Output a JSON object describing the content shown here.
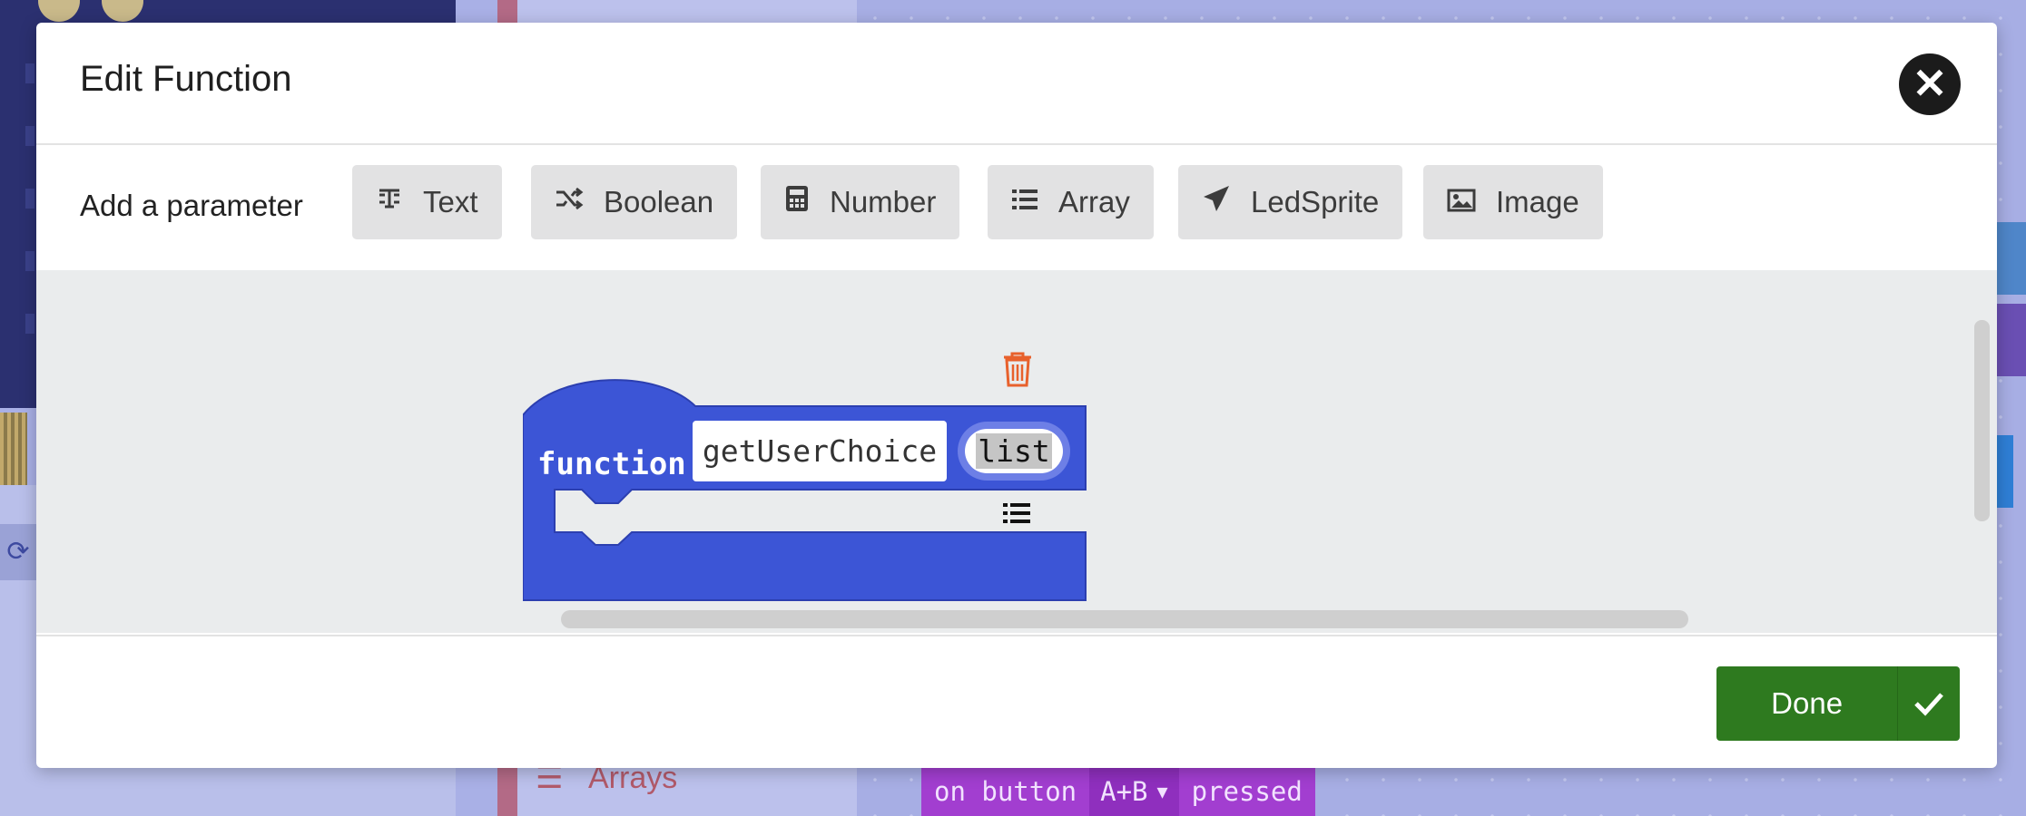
{
  "dialog": {
    "title": "Edit Function",
    "close_icon": "close-icon"
  },
  "add_parameter": {
    "label": "Add a parameter",
    "buttons": [
      {
        "label": "Text",
        "icon": "text-icon"
      },
      {
        "label": "Boolean",
        "icon": "shuffle-icon"
      },
      {
        "label": "Number",
        "icon": "calculator-icon"
      },
      {
        "label": "Array",
        "icon": "list-icon"
      },
      {
        "label": "LedSprite",
        "icon": "paper-plane-icon"
      },
      {
        "label": "Image",
        "icon": "image-icon"
      }
    ]
  },
  "function_block": {
    "keyword": "function",
    "name": "getUserChoice",
    "parameter": "list",
    "parameter_type_icon": "list-icon",
    "color": "#3c55d6",
    "delete_icon": "trash-icon"
  },
  "footer": {
    "done_label": "Done",
    "done_icon": "check-icon",
    "done_color": "#2e7a1f"
  },
  "background": {
    "toolbox_category": "Arrays",
    "event_block": {
      "prefix": "on button",
      "button": "A+B",
      "suffix": "pressed"
    }
  }
}
